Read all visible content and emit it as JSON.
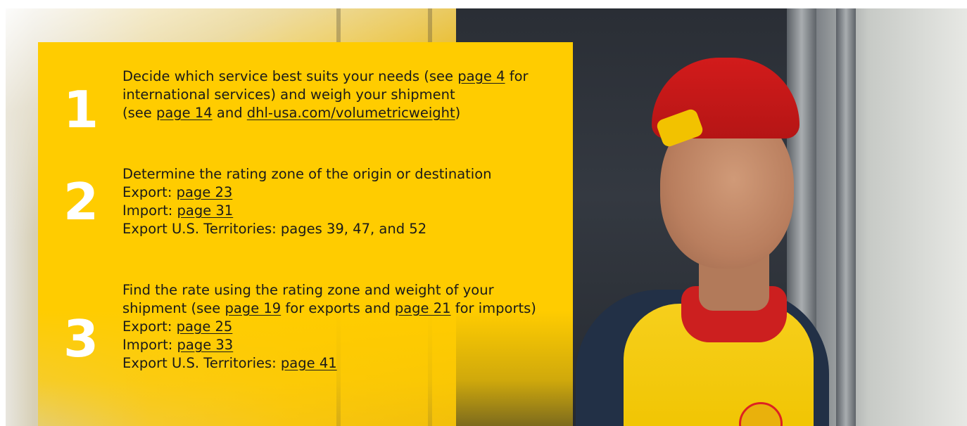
{
  "steps": [
    {
      "number": "1",
      "line1_a": "Decide which service best suits your needs (see ",
      "line1_link": "page 4",
      "line1_b": " for",
      "line2": "international services) and weigh your shipment",
      "line3_a": "(see ",
      "line3_link1": "page 14",
      "line3_mid": " and ",
      "line3_link2": "dhl-usa.com/volumetricweight",
      "line3_b": ")"
    },
    {
      "number": "2",
      "line1": "Determine the rating zone of the origin or destination",
      "line2_label": "Export: ",
      "line2_link": "page 23",
      "line3_label": "Import: ",
      "line3_link": "page 31",
      "line4": "Export U.S. Territories: pages 39, 47, and 52"
    },
    {
      "number": "3",
      "line1": "Find the rate using the rating zone and weight of your",
      "line2_a": "shipment (see ",
      "line2_link1": "page 19",
      "line2_mid": " for exports and ",
      "line2_link2": "page 21",
      "line2_b": " for imports)",
      "line3_label": "Export: ",
      "line3_link": "page 25",
      "line4_label": "Import: ",
      "line4_link": "page 33",
      "line5_label": "Export U.S. Territories: ",
      "line5_link": "page 41"
    }
  ],
  "colors": {
    "panel": "#ffcc00",
    "number": "#ffffff",
    "text": "#1a1a1a"
  }
}
